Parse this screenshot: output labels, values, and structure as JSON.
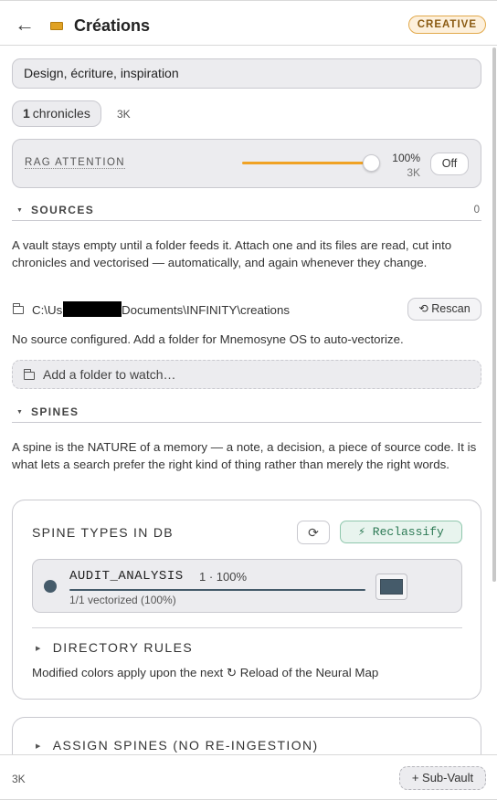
{
  "header": {
    "back_glyph": "←",
    "title": "Créations",
    "badge": "CREATIVE"
  },
  "vault": {
    "description": "Design, écriture, inspiration",
    "chronicles_count": "1",
    "chronicles_label": "chronicles",
    "size": "3K"
  },
  "rag": {
    "label": "RAG ATTENTION",
    "value_percent": 100,
    "percent_text": "100%",
    "sub_text": "3K",
    "toggle_label": "Off",
    "accent_color": "#f0a224"
  },
  "sources": {
    "heading": "SOURCES",
    "count": "0",
    "description": "A vault stays empty until a folder feeds it. Attach one and its files are read, cut into chronicles and vectorised — automatically, and again whenever they change.",
    "path_prefix": "C:\\Us",
    "path_suffix": "Documents\\INFINITY\\creations",
    "rescan_label": "⟲ Rescan",
    "empty_note": "No source configured. Add a folder for Mnemosyne OS to auto-vectorize.",
    "add_folder_label": "Add a folder to watch…"
  },
  "spines": {
    "heading": "SPINES",
    "description": "A spine is the NATURE of a memory — a note, a decision, a piece of source code. It is what lets a search prefer the right kind of thing rather than merely the right words.",
    "card_title": "SPINE TYPES IN DB",
    "refresh_glyph": "⟳",
    "reclassify_label": "⚡ Reclassify",
    "items": [
      {
        "name": "AUDIT_ANALYSIS",
        "stat": "1 · 100%",
        "vectorized": "1/1 vectorized (100%)",
        "color": "#455b6a",
        "progress": 1.0
      }
    ],
    "directory_rules_label": "DIRECTORY RULES",
    "note": "Modified colors apply upon the next ↻ Reload of the Neural Map",
    "assign_label": "ASSIGN SPINES (NO RE-INGESTION)"
  },
  "footer": {
    "size": "3K",
    "subvault_label": "+ Sub-Vault"
  }
}
